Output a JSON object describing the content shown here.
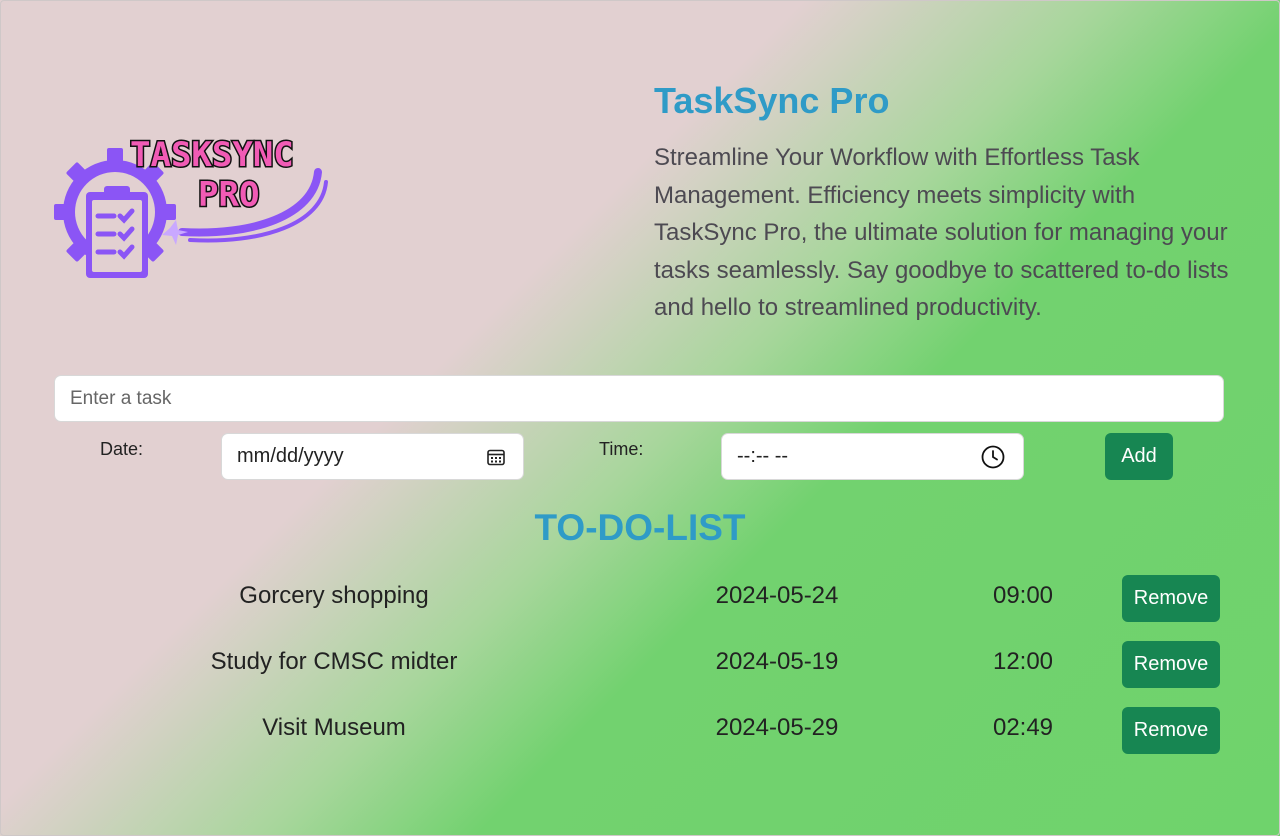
{
  "header": {
    "logo_text_line1": "TASKSYNC",
    "logo_text_line2": "PRO",
    "title": "TaskSync Pro",
    "tagline": "Streamline Your Workflow with Effortless Task Management. Efficiency meets simplicity with TaskSync Pro, the ultimate solution for managing your tasks seamlessly. Say goodbye to scattered to-do lists and hello to streamlined productivity."
  },
  "form": {
    "task_placeholder": "Enter a task",
    "task_value": "",
    "date_label": "Date:",
    "date_value": "mm/dd/yyyy",
    "date_icon": "calendar-icon",
    "time_label": "Time:",
    "time_value": "--:-- --",
    "time_icon": "clock-icon",
    "add_label": "Add"
  },
  "list": {
    "title": "TO-DO-LIST",
    "remove_label": "Remove",
    "items": [
      {
        "task": "Gorcery shopping",
        "date": "2024-05-24",
        "time": "09:00"
      },
      {
        "task": "Study for CMSC midter",
        "date": "2024-05-19",
        "time": "12:00"
      },
      {
        "task": "Visit Museum",
        "date": "2024-05-29",
        "time": "02:49"
      }
    ]
  },
  "colors": {
    "accent_title": "#2f9bc7",
    "button": "#178652",
    "logo_purple": "#8b55f5",
    "logo_pink": "#f15bb5"
  }
}
